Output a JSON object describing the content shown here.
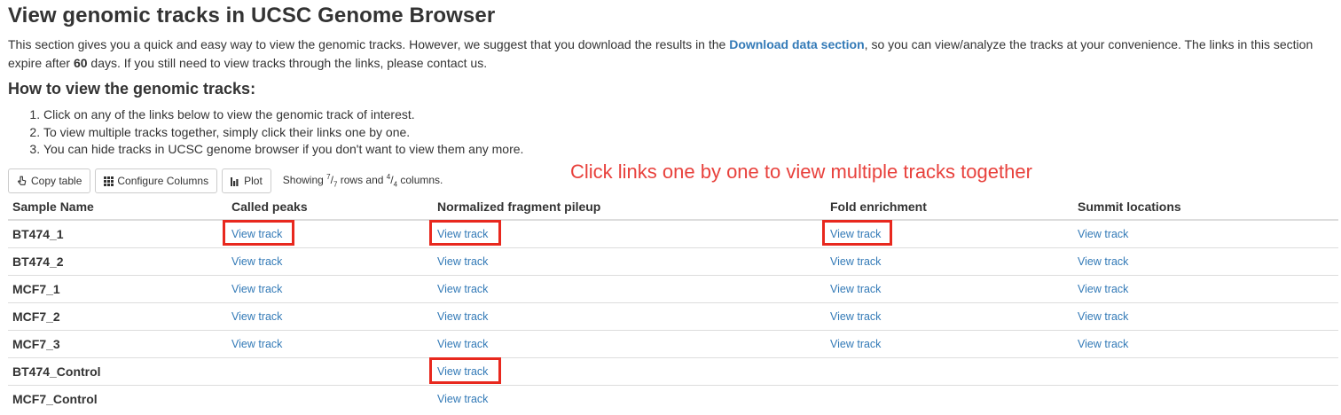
{
  "page_title": "View genomic tracks in UCSC Genome Browser",
  "intro": {
    "text_before": "This section gives you a quick and easy way to view the genomic tracks. However, we suggest that you download the results in the ",
    "link": "Download data section",
    "text_middle": ", so you can view/analyze the tracks at your convenience. The links in this section expire after ",
    "days": "60",
    "text_after": " days. If you still need to view tracks through the links, please contact us."
  },
  "how_to": {
    "title": "How to view the genomic tracks:",
    "steps": [
      "Click on any of the links below to view the genomic track of interest.",
      "To view multiple tracks together, simply click their links one by one.",
      "You can hide tracks in UCSC genome browser if you don't want to view them any more."
    ]
  },
  "toolbar": {
    "copy_label": "Copy table",
    "configure_label": "Configure Columns",
    "plot_label": "Plot",
    "showing_prefix": "Showing ",
    "rows_num": "7",
    "rows_den": "7",
    "rows_word": " rows and ",
    "cols_num": "4",
    "cols_den": "4",
    "cols_word": " columns."
  },
  "annotation": "Click links one by one to view multiple tracks together",
  "table": {
    "columns": [
      "Sample Name",
      "Called peaks",
      "Normalized fragment pileup",
      "Fold enrichment",
      "Summit locations"
    ],
    "rows": [
      {
        "sample": "BT474_1",
        "cells": [
          "View track",
          "View track",
          "View track",
          "View track"
        ]
      },
      {
        "sample": "BT474_2",
        "cells": [
          "View track",
          "View track",
          "View track",
          "View track"
        ]
      },
      {
        "sample": "MCF7_1",
        "cells": [
          "View track",
          "View track",
          "View track",
          "View track"
        ]
      },
      {
        "sample": "MCF7_2",
        "cells": [
          "View track",
          "View track",
          "View track",
          "View track"
        ]
      },
      {
        "sample": "MCF7_3",
        "cells": [
          "View track",
          "View track",
          "View track",
          "View track"
        ]
      },
      {
        "sample": "BT474_Control",
        "cells": [
          "",
          "View track",
          "",
          ""
        ]
      },
      {
        "sample": "MCF7_Control",
        "cells": [
          "",
          "View track",
          "",
          ""
        ]
      }
    ]
  },
  "colors": {
    "link": "#337ab7",
    "annotation": "#e8413c",
    "highlight": "#e8281e"
  }
}
